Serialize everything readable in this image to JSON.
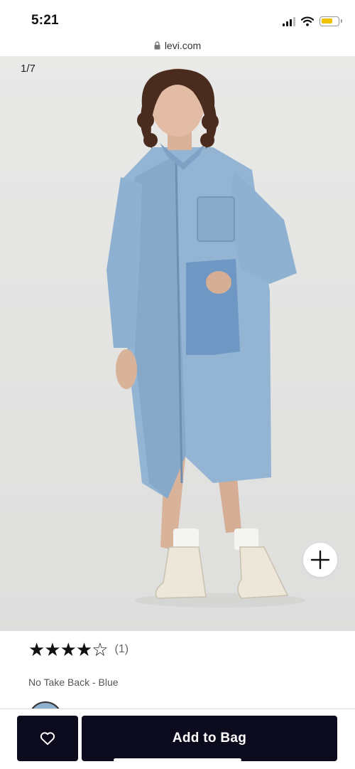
{
  "status_bar": {
    "time": "5:21",
    "battery_color": "#f2c200"
  },
  "browser": {
    "url": "levi.com",
    "lock_icon": "lock-icon"
  },
  "gallery": {
    "counter": "1/7",
    "background": "#e8e8e7",
    "zoom_icon": "plus-icon"
  },
  "product": {
    "rating_stars": "★★★★☆",
    "rating_value": 4,
    "review_count": "(1)",
    "color_label": "No Take Back - Blue",
    "swatch_color": "#8eb0cf"
  },
  "actions": {
    "wishlist_icon": "heart-outline-icon",
    "add_to_bag": "Add to Bag",
    "button_color": "#0b0b1d"
  }
}
